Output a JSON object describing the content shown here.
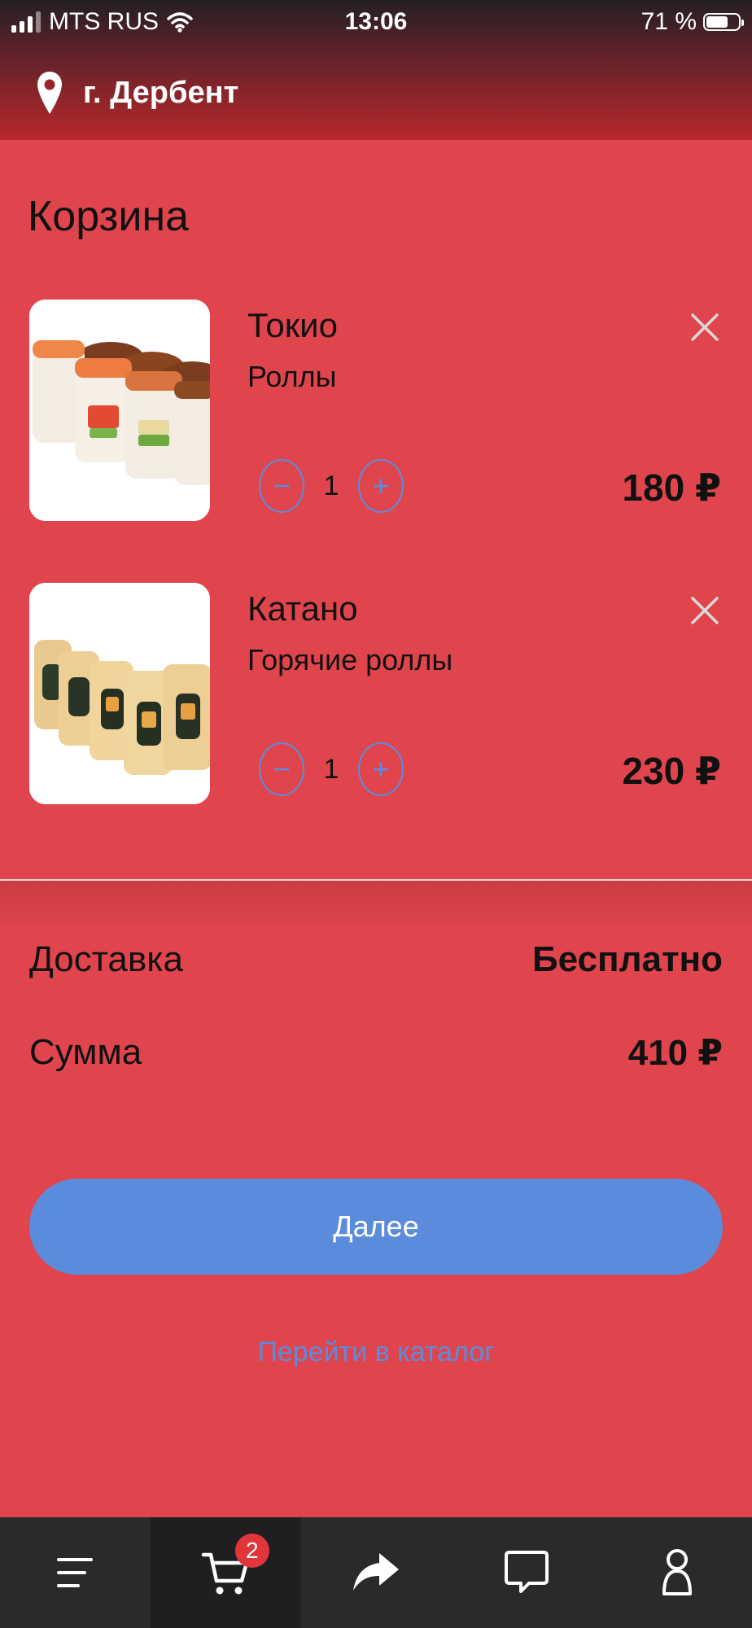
{
  "status_bar": {
    "carrier": "MTS RUS",
    "time": "13:06",
    "battery_percent": "71 %",
    "battery_level": 0.71
  },
  "header": {
    "location_icon": "map-pin-icon",
    "city": "г. Дербент"
  },
  "cart": {
    "title": "Корзина",
    "items": [
      {
        "name": "Токио",
        "category": "Роллы",
        "quantity": "1",
        "price": "180 ₽"
      },
      {
        "name": "Катано",
        "category": "Горячие роллы",
        "quantity": "1",
        "price": "230 ₽"
      }
    ],
    "minus_symbol": "−",
    "plus_symbol": "+"
  },
  "summary": {
    "delivery_label": "Доставка",
    "delivery_value": "Бесплатно",
    "total_label": "Сумма",
    "total_value": "410 ₽"
  },
  "actions": {
    "next_label": "Далее",
    "catalog_link": "Перейти в каталог"
  },
  "tabbar": {
    "tabs": [
      {
        "icon": "menu-icon"
      },
      {
        "icon": "cart-icon",
        "badge": "2",
        "active": true
      },
      {
        "icon": "share-icon"
      },
      {
        "icon": "chat-icon"
      },
      {
        "icon": "profile-icon"
      }
    ]
  },
  "colors": {
    "background": "#e0454d",
    "accent": "#5b8cdc",
    "tabbar": "#2a2a2c",
    "badge": "#e0353b"
  }
}
